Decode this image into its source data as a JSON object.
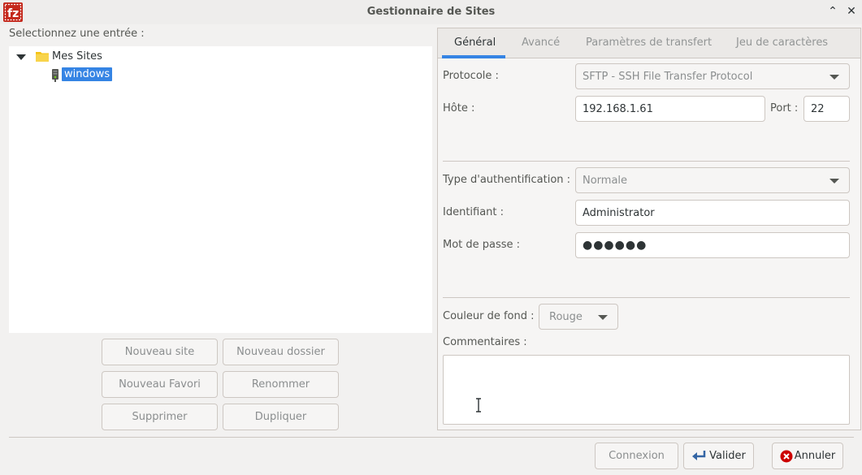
{
  "window": {
    "title": "Gestionnaire de Sites",
    "minimize_glyph": "⌃",
    "close_glyph": "✕"
  },
  "left": {
    "label": "Selectionnez une entrée :",
    "tree": {
      "root": "Mes Sites",
      "items": [
        {
          "label": "windows",
          "selected": true
        }
      ]
    },
    "buttons": {
      "new_site": "Nouveau site",
      "new_folder": "Nouveau dossier",
      "new_bookmark": "Nouveau Favori",
      "rename": "Renommer",
      "delete": "Supprimer",
      "duplicate": "Dupliquer"
    }
  },
  "tabs": [
    {
      "label": "Général",
      "active": true
    },
    {
      "label": "Avancé",
      "active": false
    },
    {
      "label": "Paramètres de transfert",
      "active": false
    },
    {
      "label": "Jeu de caractères",
      "active": false
    }
  ],
  "general": {
    "protocol_label": "Protocole :",
    "protocol_value": "SFTP - SSH File Transfer Protocol",
    "host_label": "Hôte :",
    "host_value": "192.168.1.61",
    "port_label": "Port :",
    "port_value": "22",
    "auth_label": "Type d'authentification :",
    "auth_value": "Normale",
    "user_label": "Identifiant :",
    "user_value": "Administrator",
    "password_label": "Mot de passe :",
    "password_value": "●●●●●●",
    "bgcolor_label": "Couleur de fond :",
    "bgcolor_value": "Rouge",
    "comments_label": "Commentaires :"
  },
  "footer": {
    "connect": "Connexion",
    "ok": "Valider",
    "cancel": "Annuler"
  },
  "colors": {
    "accent": "#3584e4",
    "app_icon_red": "#c4281c"
  }
}
